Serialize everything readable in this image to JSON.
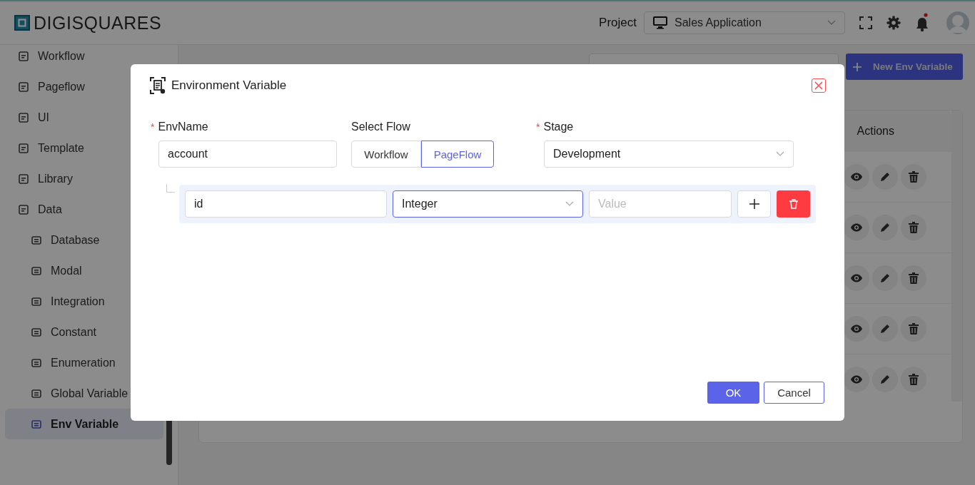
{
  "header": {
    "logo": "DIGISQUARES",
    "project_label": "Project",
    "project_select": "Sales Application"
  },
  "sidebar": {
    "items": [
      {
        "label": "Workflow",
        "selected": false
      },
      {
        "label": "Pageflow",
        "selected": false
      },
      {
        "label": "UI",
        "selected": false
      },
      {
        "label": "Template",
        "selected": false
      },
      {
        "label": "Library",
        "selected": false
      },
      {
        "label": "Data",
        "selected": false,
        "children": [
          {
            "label": "Database",
            "selected": false
          },
          {
            "label": "Modal",
            "selected": false
          },
          {
            "label": "Integration",
            "selected": false
          },
          {
            "label": "Constant",
            "selected": false
          },
          {
            "label": "Enumeration",
            "selected": false
          },
          {
            "label": "Global Variable",
            "selected": false
          },
          {
            "label": "Env Variable",
            "selected": true
          }
        ]
      }
    ]
  },
  "main": {
    "new_button": "New Env Variable",
    "table": {
      "columns": [
        "Actions"
      ]
    }
  },
  "modal": {
    "title": "Environment Variable",
    "env_name": {
      "label": "EnvName",
      "required_mark": "*",
      "value": "account"
    },
    "select_flow": {
      "label": "Select Flow",
      "options": [
        {
          "label": "Workflow",
          "selected": false
        },
        {
          "label": "PageFlow",
          "selected": true
        }
      ]
    },
    "stage": {
      "label": "Stage",
      "required_mark": "*",
      "value": "Development"
    },
    "variables": [
      {
        "name": "id",
        "type": "Integer",
        "type_focused": true,
        "value_placeholder": "Value"
      }
    ],
    "buttons": {
      "ok": "OK",
      "cancel": "Cancel"
    }
  }
}
